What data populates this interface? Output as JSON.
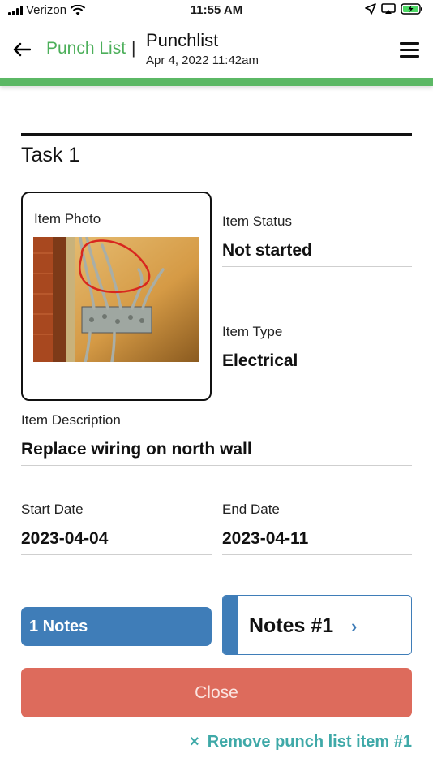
{
  "status_bar": {
    "carrier": "Verizon",
    "time": "11:55 AM",
    "icons": [
      "signal-icon",
      "wifi-icon",
      "location-icon",
      "screen-mirroring-icon",
      "battery-charging-icon"
    ]
  },
  "header": {
    "back_icon": "back-arrow-icon",
    "breadcrumb": "Punch List",
    "separator": "|",
    "title": "Punchlist",
    "subtitle": "Apr 4, 2022 11:42am",
    "menu_icon": "hamburger-menu-icon"
  },
  "colors": {
    "accent_green": "#5cb865",
    "breadcrumb_green": "#4caf5a",
    "notes_blue": "#3f7db8",
    "close_red": "#dd6b5c",
    "remove_teal": "#3fa9a8"
  },
  "task": {
    "title": "Task 1",
    "photo_label": "Item Photo",
    "status_label": "Item Status",
    "status_value": "Not started",
    "type_label": "Item Type",
    "type_value": "Electrical",
    "description_label": "Item Description",
    "description_value": "Replace wiring on north wall",
    "start_label": "Start Date",
    "start_value": "2023-04-04",
    "end_label": "End Date",
    "end_value": "2023-04-11"
  },
  "notes": {
    "count_label": "1 Notes",
    "card_title": "Notes #1",
    "chevron": "›"
  },
  "actions": {
    "close_label": "Close",
    "remove_icon": "×",
    "remove_label": "Remove punch list item #1"
  }
}
